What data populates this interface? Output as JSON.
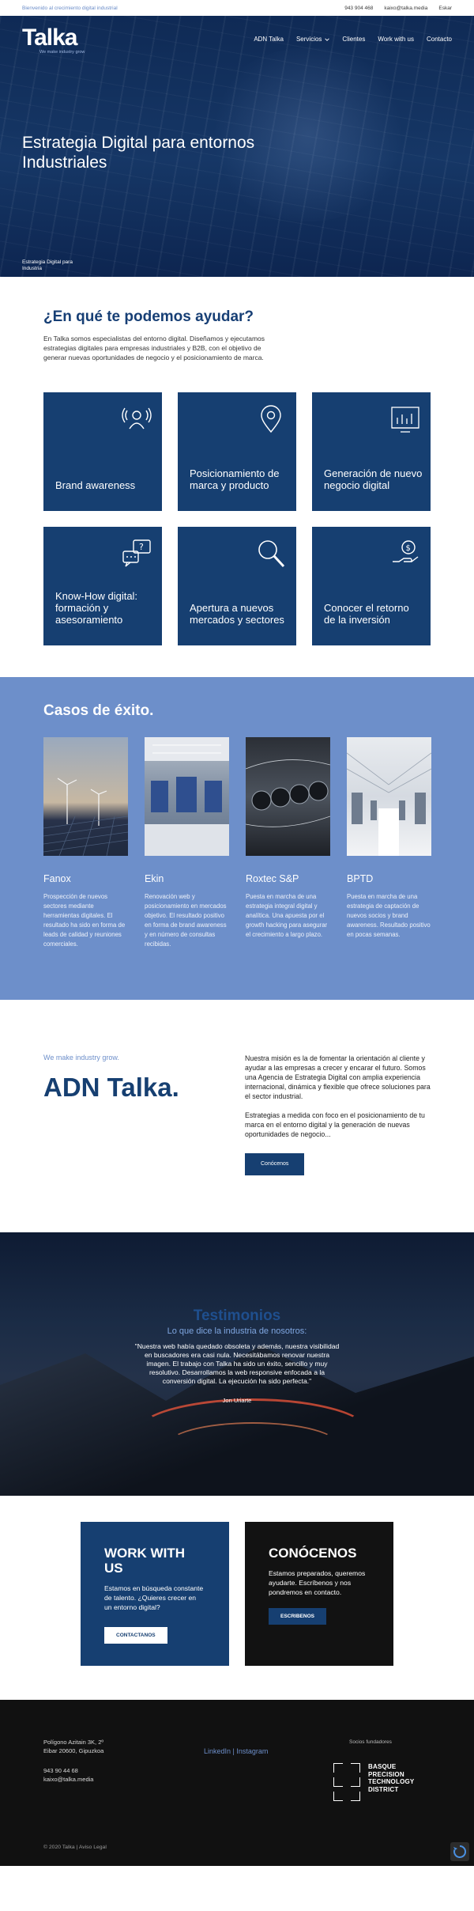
{
  "topbar": {
    "slogan": "Bienvenido al crecimiento digital industrial",
    "phone": "943 904 468",
    "email": "kaixo@talka.media",
    "language": "Eskar"
  },
  "header": {
    "logo_text": "Talka",
    "logo_tagline": "We make industry grow",
    "menu": [
      {
        "label": "ADN Talka"
      },
      {
        "label": "Servicios"
      },
      {
        "label": "Clientes"
      },
      {
        "label": "Work with us"
      },
      {
        "label": "Contacto"
      }
    ]
  },
  "hero": {
    "title": "Estrategia Digital para entornos Industriales",
    "breadcrumb": "Estrategia Digital para Industria"
  },
  "help": {
    "title": "¿En qué te podemos ayudar?",
    "text": "En Talka somos especialistas del entorno digital. Diseñamos y ejecutamos estrategias digitales para empresas industriales y B2B, con el objetivo de generar nuevas oportunidades de negocio y el posicionamiento de marca.",
    "cards": [
      {
        "label": "Brand awareness",
        "icon": "audience-icon"
      },
      {
        "label": "Posicionamiento de marca y producto",
        "icon": "location-pin-icon"
      },
      {
        "label": "Generación de nuevo negocio digital",
        "icon": "growth-icon"
      },
      {
        "label": "Know-How digital: formación y asesoramiento",
        "icon": "chat-question-icon"
      },
      {
        "label": "Apertura a nuevos mercados y sectores",
        "icon": "magnifier-icon"
      },
      {
        "label": "Conocer el retorno de la inversión",
        "icon": "money-hand-icon"
      }
    ]
  },
  "success": {
    "title": "Casos de éxito.",
    "cases": [
      {
        "name": "Fanox",
        "desc": "Prospección de nuevos sectores mediante herramientas digitales. El resultado ha sido en forma de leads de calidad y reuniones comerciales.",
        "color": "#7a8aa0"
      },
      {
        "name": "Ekin",
        "desc": "Renovación web y posicionamiento en mercados objetivo. El resultado positivo en forma de brand awareness y en número de consultas recibidas.",
        "color": "#8a9ab0"
      },
      {
        "name": "Roxtec S&P",
        "desc": "Puesta en marcha de una estrategia integral digital y analítica. Una apuesta por el growth hacking para asegurar el crecimiento a largo plazo.",
        "color": "#3a3f48"
      },
      {
        "name": "BPTD",
        "desc": "Puesta en marcha de una estrategia de captación de nuevos socios y brand awareness. Resultado positivo en pocas semanas.",
        "color": "#c4c8cf"
      }
    ]
  },
  "adn": {
    "kicker": "We make industry grow.",
    "title": "ADN Talka.",
    "p1": "Nuestra misión es la de fomentar la orientación al cliente y ayudar a las empresas a crecer y encarar el futuro. Somos una Agencia de Estrategia Digital con amplia experiencia internacional, dinámica y flexible que ofrece soluciones para el sector industrial.",
    "p2": "Estrategias a medida con foco en el posicionamiento de tu marca en el entorno digital y la generación de nuevas oportunidades de negocio...",
    "button": "Conócenos"
  },
  "testimonials": {
    "title": "Testimonios",
    "subtitle": "Lo que dice la industria de nosotros:",
    "quote": "\"Nuestra web había quedado obsoleta y además, nuestra visibilidad en buscadores era casi nula. Necesitábamos renovar nuestra imagen. El trabajo con Talka ha sido un éxito, sencillo y muy resolutivo. Desarrollamos la web responsive enfocada a la conversión digital. La ejecución ha sido perfecta.\"",
    "author": "Jon Uriarte"
  },
  "cta": {
    "work": {
      "title": "WORK WITH US",
      "text": "Estamos en búsqueda constante de talento. ¿Quieres crecer en un entorno digital?",
      "button": "CONTACTANOS"
    },
    "meet": {
      "title": "CONÓCENOS",
      "text": "Estamos preparados, queremos ayudarte. Escríbenos y nos pondremos en contacto.",
      "button": "ESCRIBENOS"
    }
  },
  "footer": {
    "address1": "Polígono Azitain 3K, 2º",
    "address2": "Eibar 20600, Gipuzkoa",
    "phone": "943 90 44 68",
    "email": "kaixo@talka.media",
    "social_linkedin": "LinkedIn",
    "social_sep": " | ",
    "social_instagram": "Instagram",
    "partners_label": "Socios fundadores",
    "partner_lines": [
      "BASQUE",
      "PRECISION",
      "TECHNOLOGY",
      "DISTRICT"
    ],
    "copyright": "© 2020 Talka | Aviso Legal"
  }
}
